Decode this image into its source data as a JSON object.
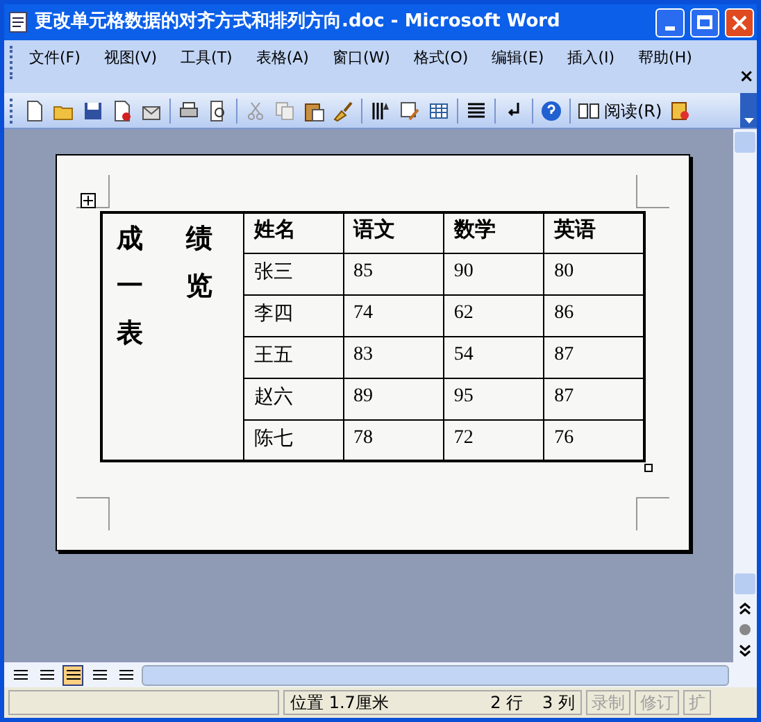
{
  "window": {
    "title": "更改单元格数据的对齐方式和排列方向.doc - Microsoft Word"
  },
  "menu": [
    "文件(F)",
    "视图(V)",
    "工具(T)",
    "表格(A)",
    "窗口(W)",
    "格式(O)",
    "编辑(E)",
    "插入(I)",
    "帮助(H)"
  ],
  "menu_close": "×",
  "toolbar": {
    "read_button": "阅读(R)"
  },
  "table": {
    "title": "成绩一览表",
    "columns": [
      "姓名",
      "语文",
      "数学",
      "英语"
    ],
    "rows": [
      [
        "张三",
        "85",
        "90",
        "80"
      ],
      [
        "李四",
        "74",
        "62",
        "86"
      ],
      [
        "王五",
        "83",
        "54",
        "87"
      ],
      [
        "赵六",
        "89",
        "95",
        "87"
      ],
      [
        "陈七",
        "78",
        "72",
        "76"
      ]
    ]
  },
  "view_buttons": [
    {
      "selected": false
    },
    {
      "selected": false
    },
    {
      "selected": true
    },
    {
      "selected": false
    },
    {
      "selected": false
    }
  ],
  "status_bar": {
    "position": "位置 1.7厘米",
    "row": "2 行",
    "column": "3 列",
    "modes": [
      "录制",
      "修订",
      "扩"
    ]
  }
}
